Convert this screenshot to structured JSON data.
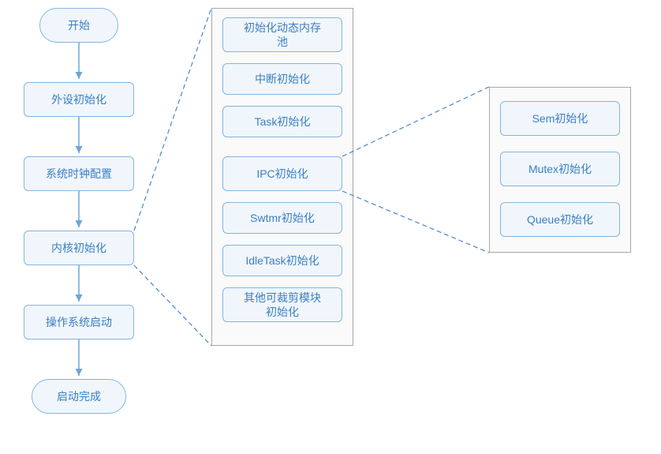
{
  "main_flow": {
    "start": "开始",
    "peripheral_init": "外设初始化",
    "clock_config": "系统时钟配置",
    "kernel_init": "内核初始化",
    "os_start": "操作系统启动",
    "boot_done": "启动完成"
  },
  "kernel_detail": {
    "mempool_init": "初始化动态内存\n池",
    "interrupt_init": "中断初始化",
    "task_init": "Task初始化",
    "ipc_init": "IPC初始化",
    "swtmr_init": "Swtmr初始化",
    "idletask_init": "IdleTask初始化",
    "trim_module_init": "其他可裁剪模块\n初始化"
  },
  "ipc_detail": {
    "sem_init": "Sem初始化",
    "mutex_init": "Mutex初始化",
    "queue_init": "Queue初始化"
  },
  "colors": {
    "node_fill": "#f0f6fb",
    "node_border": "#85b5df",
    "text": "#3b7fc4",
    "arrow": "#6da6d6",
    "dash": "#4a86c5",
    "container_border": "#a8a8a8"
  }
}
